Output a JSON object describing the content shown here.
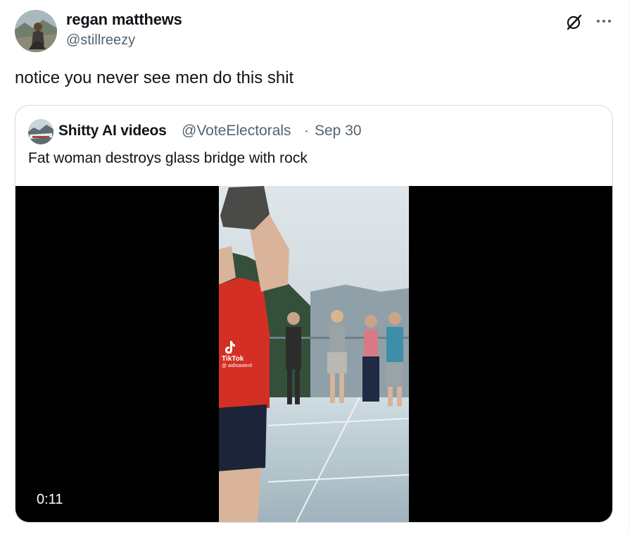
{
  "author": {
    "display_name": "regan matthews",
    "handle": "@stillreezy"
  },
  "tweet": {
    "text": "notice you never see men do this shit"
  },
  "icons": {
    "grok": "grok-icon",
    "more": "more-dots-icon"
  },
  "quoted_tweet": {
    "display_name": "Shitty AI videos",
    "handle": "@VoteElectorals",
    "separator": "·",
    "date": "Sep 30",
    "text": "Fat woman destroys glass bridge with rock",
    "video": {
      "duration": "0:11",
      "watermark_brand": "TikTok",
      "watermark_user": "@ aidisasterd"
    }
  },
  "colors": {
    "text_primary": "#0f1419",
    "text_secondary": "#536471",
    "border": "#cfd9de",
    "video_bg": "#000000"
  }
}
